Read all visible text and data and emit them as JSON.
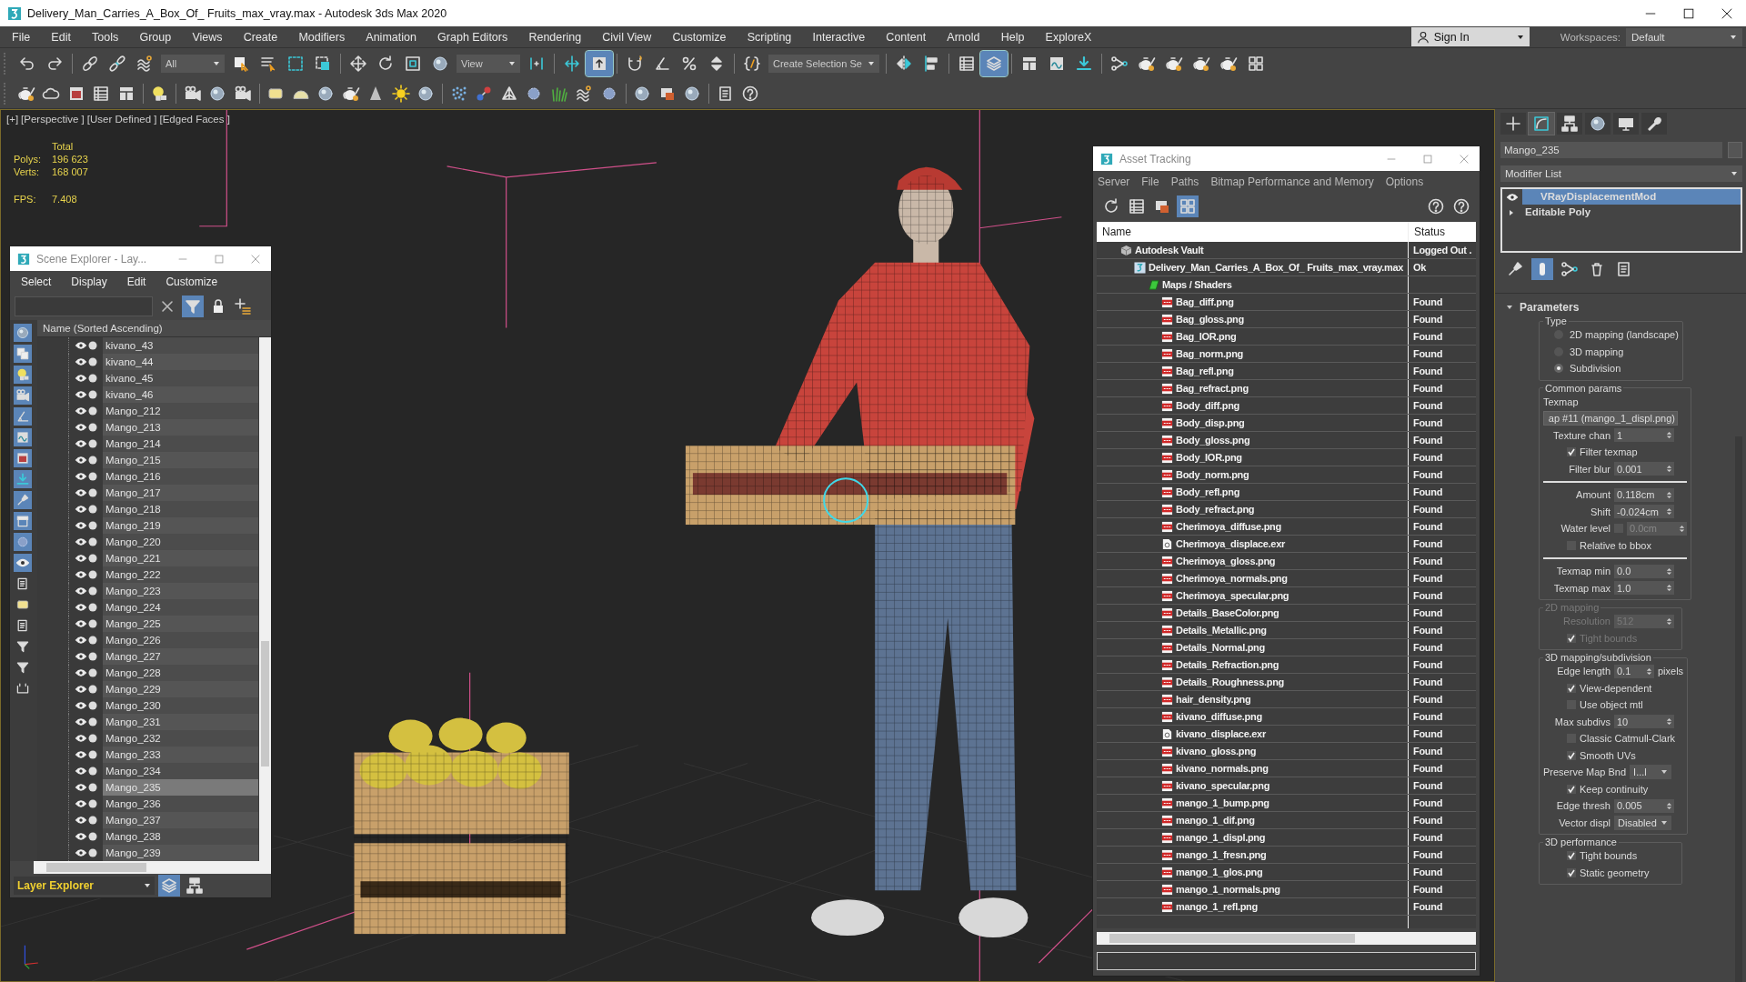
{
  "window": {
    "title": "Delivery_Man_Carries_A_Box_Of_ Fruits_max_vray.max - Autodesk 3ds Max 2020"
  },
  "menu": [
    "File",
    "Edit",
    "Tools",
    "Group",
    "Views",
    "Create",
    "Modifiers",
    "Animation",
    "Graph Editors",
    "Rendering",
    "Civil View",
    "Customize",
    "Scripting",
    "Interactive",
    "Content",
    "Arnold",
    "Help",
    "ExploreX"
  ],
  "sign_in": "Sign In",
  "workspaces": {
    "label": "Workspaces:",
    "value": "Default"
  },
  "toolbar_main": [
    {
      "kind": "button",
      "selected": false
    },
    {
      "kind": "button",
      "selected": false
    },
    {
      "kind": "separator"
    },
    {
      "kind": "button",
      "selected": false
    },
    {
      "kind": "button",
      "selected": false
    },
    {
      "kind": "button",
      "selected": false
    },
    {
      "kind": "dropdown",
      "value": "All"
    },
    {
      "kind": "button",
      "selected": false
    },
    {
      "kind": "button",
      "selected": false
    },
    {
      "kind": "button",
      "selected": false
    },
    {
      "kind": "button",
      "selected": false
    },
    {
      "kind": "separator"
    },
    {
      "kind": "button",
      "selected": false
    },
    {
      "kind": "button",
      "selected": false
    },
    {
      "kind": "button",
      "selected": false
    },
    {
      "kind": "button",
      "selected": false
    },
    {
      "kind": "dropdown",
      "value": "View"
    },
    {
      "kind": "button",
      "selected": false
    },
    {
      "kind": "separator"
    },
    {
      "kind": "button",
      "selected": false
    },
    {
      "kind": "button",
      "selected": true
    },
    {
      "kind": "separator"
    },
    {
      "kind": "button",
      "selected": false
    },
    {
      "kind": "button",
      "selected": false
    },
    {
      "kind": "button",
      "selected": false
    },
    {
      "kind": "button",
      "selected": false
    },
    {
      "kind": "separator"
    },
    {
      "kind": "button",
      "selected": false
    },
    {
      "kind": "dropdown",
      "value": "Create Selection Se"
    },
    {
      "kind": "separator"
    },
    {
      "kind": "button",
      "selected": false
    },
    {
      "kind": "button",
      "selected": false
    },
    {
      "kind": "separator"
    },
    {
      "kind": "button",
      "selected": false
    },
    {
      "kind": "button",
      "selected": true
    },
    {
      "kind": "separator"
    },
    {
      "kind": "button",
      "selected": false
    },
    {
      "kind": "button",
      "selected": false
    },
    {
      "kind": "button",
      "selected": false
    },
    {
      "kind": "separator"
    },
    {
      "kind": "button",
      "selected": false
    },
    {
      "kind": "button",
      "selected": false
    },
    {
      "kind": "button",
      "selected": false
    },
    {
      "kind": "button",
      "selected": false
    },
    {
      "kind": "button",
      "selected": false
    },
    {
      "kind": "button",
      "selected": false
    }
  ],
  "toolbar_create": [
    {
      "kind": "button",
      "selected": false
    },
    {
      "kind": "button",
      "selected": false
    },
    {
      "kind": "button",
      "selected": false
    },
    {
      "kind": "button",
      "selected": false
    },
    {
      "kind": "button",
      "selected": false
    },
    {
      "kind": "separator"
    },
    {
      "kind": "button",
      "selected": false
    },
    {
      "kind": "separator"
    },
    {
      "kind": "button",
      "selected": false
    },
    {
      "kind": "button",
      "selected": false
    },
    {
      "kind": "button",
      "selected": false
    },
    {
      "kind": "separator"
    },
    {
      "kind": "button",
      "selected": false
    },
    {
      "kind": "button",
      "selected": false
    },
    {
      "kind": "button",
      "selected": false
    },
    {
      "kind": "button",
      "selected": false
    },
    {
      "kind": "button",
      "selected": false
    },
    {
      "kind": "button",
      "selected": false
    },
    {
      "kind": "button",
      "selected": false
    },
    {
      "kind": "separator"
    },
    {
      "kind": "button",
      "selected": false
    },
    {
      "kind": "button",
      "selected": false
    },
    {
      "kind": "button",
      "selected": false
    },
    {
      "kind": "button",
      "selected": false
    },
    {
      "kind": "button",
      "selected": false
    },
    {
      "kind": "button",
      "selected": false
    },
    {
      "kind": "button",
      "selected": false
    },
    {
      "kind": "separator"
    },
    {
      "kind": "button",
      "selected": false
    },
    {
      "kind": "button",
      "selected": false
    },
    {
      "kind": "button",
      "selected": false
    },
    {
      "kind": "separator"
    },
    {
      "kind": "button",
      "selected": false
    },
    {
      "kind": "button",
      "selected": false
    }
  ],
  "viewport": {
    "labels": [
      "[+]",
      "[Perspective ]",
      "[User Defined ]",
      "[Edged Faces ]"
    ],
    "stats": {
      "heading": "Total",
      "rows": [
        {
          "label": "Polys:",
          "value": "196 623"
        },
        {
          "label": "Verts:",
          "value": "168 007"
        }
      ],
      "fps_label": "FPS:",
      "fps": "7.408"
    }
  },
  "scene_explorer": {
    "title": "Scene Explorer - Lay...",
    "menu": [
      "Select",
      "Display",
      "Edit",
      "Customize"
    ],
    "tools": [
      {
        "selected": false
      },
      {
        "selected": true
      },
      {
        "selected": false
      },
      {
        "selected": false
      }
    ],
    "filters": [
      {
        "on": true
      },
      {
        "on": true
      },
      {
        "on": true
      },
      {
        "on": true
      },
      {
        "on": true
      },
      {
        "on": true
      },
      {
        "on": true
      },
      {
        "on": true
      },
      {
        "on": true
      },
      {
        "on": true
      },
      {
        "on": true
      },
      {
        "on": true
      },
      {
        "on": false
      },
      {
        "on": false
      },
      {
        "on": false
      },
      {
        "on": false
      },
      {
        "on": false
      },
      {
        "on": false
      }
    ],
    "column": "Name (Sorted Ascending)",
    "rows": [
      {
        "name": "kivano_43",
        "selected": false
      },
      {
        "name": "kivano_44",
        "selected": false
      },
      {
        "name": "kivano_45",
        "selected": false
      },
      {
        "name": "kivano_46",
        "selected": false
      },
      {
        "name": "Mango_212",
        "selected": false
      },
      {
        "name": "Mango_213",
        "selected": false
      },
      {
        "name": "Mango_214",
        "selected": false
      },
      {
        "name": "Mango_215",
        "selected": false
      },
      {
        "name": "Mango_216",
        "selected": false
      },
      {
        "name": "Mango_217",
        "selected": false
      },
      {
        "name": "Mango_218",
        "selected": false
      },
      {
        "name": "Mango_219",
        "selected": false
      },
      {
        "name": "Mango_220",
        "selected": false
      },
      {
        "name": "Mango_221",
        "selected": false
      },
      {
        "name": "Mango_222",
        "selected": false
      },
      {
        "name": "Mango_223",
        "selected": false
      },
      {
        "name": "Mango_224",
        "selected": false
      },
      {
        "name": "Mango_225",
        "selected": false
      },
      {
        "name": "Mango_226",
        "selected": false
      },
      {
        "name": "Mango_227",
        "selected": false
      },
      {
        "name": "Mango_228",
        "selected": false
      },
      {
        "name": "Mango_229",
        "selected": false
      },
      {
        "name": "Mango_230",
        "selected": false
      },
      {
        "name": "Mango_231",
        "selected": false
      },
      {
        "name": "Mango_232",
        "selected": false
      },
      {
        "name": "Mango_233",
        "selected": false
      },
      {
        "name": "Mango_234",
        "selected": false
      },
      {
        "name": "Mango_235",
        "selected": true
      },
      {
        "name": "Mango_236",
        "selected": false
      },
      {
        "name": "Mango_237",
        "selected": false
      },
      {
        "name": "Mango_238",
        "selected": false
      },
      {
        "name": "Mango_239",
        "selected": false
      }
    ],
    "footer": {
      "value": "Layer Explorer",
      "buttons": [
        {
          "selected": true
        },
        {
          "selected": false
        }
      ]
    }
  },
  "asset_tracking": {
    "title": "Asset Tracking",
    "menu": [
      "Server",
      "File",
      "Paths",
      "Bitmap Performance and Memory",
      "Options"
    ],
    "toolbar_left": [
      {
        "selected": false
      },
      {
        "selected": false
      },
      {
        "selected": false
      },
      {
        "selected": true
      }
    ],
    "toolbar_right": [
      {
        "selected": false
      },
      {
        "selected": false
      }
    ],
    "columns": [
      "Name",
      "Status"
    ],
    "tree": [
      {
        "name": "Autodesk Vault",
        "status": "Logged Out .",
        "kind": "vault",
        "children": [
          {
            "name": "Delivery_Man_Carries_A_Box_Of_ Fruits_max_vray.max",
            "status": "Ok",
            "kind": "scene",
            "children": [
              {
                "name": "Maps / Shaders",
                "kind": "folder",
                "children": [
                  {
                    "name": "Bag_diff.png",
                    "status": "Found",
                    "kind": "png"
                  },
                  {
                    "name": "Bag_gloss.png",
                    "status": "Found",
                    "kind": "png"
                  },
                  {
                    "name": "Bag_IOR.png",
                    "status": "Found",
                    "kind": "png"
                  },
                  {
                    "name": "Bag_norm.png",
                    "status": "Found",
                    "kind": "png"
                  },
                  {
                    "name": "Bag_refl.png",
                    "status": "Found",
                    "kind": "png"
                  },
                  {
                    "name": "Bag_refract.png",
                    "status": "Found",
                    "kind": "png"
                  },
                  {
                    "name": "Body_diff.png",
                    "status": "Found",
                    "kind": "png"
                  },
                  {
                    "name": "Body_disp.png",
                    "status": "Found",
                    "kind": "png"
                  },
                  {
                    "name": "Body_gloss.png",
                    "status": "Found",
                    "kind": "png"
                  },
                  {
                    "name": "Body_IOR.png",
                    "status": "Found",
                    "kind": "png"
                  },
                  {
                    "name": "Body_norm.png",
                    "status": "Found",
                    "kind": "png"
                  },
                  {
                    "name": "Body_refl.png",
                    "status": "Found",
                    "kind": "png"
                  },
                  {
                    "name": "Body_refract.png",
                    "status": "Found",
                    "kind": "png"
                  },
                  {
                    "name": "Cherimoya_diffuse.png",
                    "status": "Found",
                    "kind": "png"
                  },
                  {
                    "name": "Cherimoya_displace.exr",
                    "status": "Found",
                    "kind": "exr"
                  },
                  {
                    "name": "Cherimoya_gloss.png",
                    "status": "Found",
                    "kind": "png"
                  },
                  {
                    "name": "Cherimoya_normals.png",
                    "status": "Found",
                    "kind": "png"
                  },
                  {
                    "name": "Cherimoya_specular.png",
                    "status": "Found",
                    "kind": "png"
                  },
                  {
                    "name": "Details_BaseColor.png",
                    "status": "Found",
                    "kind": "png"
                  },
                  {
                    "name": "Details_Metallic.png",
                    "status": "Found",
                    "kind": "png"
                  },
                  {
                    "name": "Details_Normal.png",
                    "status": "Found",
                    "kind": "png"
                  },
                  {
                    "name": "Details_Refraction.png",
                    "status": "Found",
                    "kind": "png"
                  },
                  {
                    "name": "Details_Roughness.png",
                    "status": "Found",
                    "kind": "png"
                  },
                  {
                    "name": "hair_density.png",
                    "status": "Found",
                    "kind": "png"
                  },
                  {
                    "name": "kivano_diffuse.png",
                    "status": "Found",
                    "kind": "png"
                  },
                  {
                    "name": "kivano_displace.exr",
                    "status": "Found",
                    "kind": "exr"
                  },
                  {
                    "name": "kivano_gloss.png",
                    "status": "Found",
                    "kind": "png"
                  },
                  {
                    "name": "kivano_normals.png",
                    "status": "Found",
                    "kind": "png"
                  },
                  {
                    "name": "kivano_specular.png",
                    "status": "Found",
                    "kind": "png"
                  },
                  {
                    "name": "mango_1_bump.png",
                    "status": "Found",
                    "kind": "png"
                  },
                  {
                    "name": "mango_1_dif.png",
                    "status": "Found",
                    "kind": "png"
                  },
                  {
                    "name": "mango_1_displ.png",
                    "status": "Found",
                    "kind": "png"
                  },
                  {
                    "name": "mango_1_fresn.png",
                    "status": "Found",
                    "kind": "png"
                  },
                  {
                    "name": "mango_1_glos.png",
                    "status": "Found",
                    "kind": "png"
                  },
                  {
                    "name": "mango_1_normals.png",
                    "status": "Found",
                    "kind": "png"
                  },
                  {
                    "name": "mango_1_refl.png",
                    "status": "Found",
                    "kind": "png"
                  }
                ]
              }
            ]
          }
        ]
      }
    ]
  },
  "command_panel": {
    "tabs": [
      {
        "selected": false
      },
      {
        "selected": true
      },
      {
        "selected": false
      },
      {
        "selected": false
      },
      {
        "selected": false
      },
      {
        "selected": false
      }
    ],
    "object_name": "Mango_235",
    "modifier_list": "Modifier List",
    "stack": [
      {
        "name": "VRayDisplacementMod",
        "kind": "modifier",
        "selected": true
      },
      {
        "name": "Editable Poly",
        "kind": "base",
        "selected": false
      }
    ],
    "stack_tools": [
      {
        "selected": false
      },
      {
        "selected": true
      },
      {
        "selected": false
      },
      {
        "selected": false
      },
      {
        "selected": false
      }
    ],
    "rollout": {
      "title": "Parameters",
      "expanded": true,
      "groups": [
        {
          "title": "Type",
          "disabled": false,
          "rows": [
            {
              "kind": "radio",
              "label": "2D mapping (landscape)",
              "selected": false
            },
            {
              "kind": "radio",
              "label": "3D mapping",
              "selected": false
            },
            {
              "kind": "radio",
              "label": "Subdivision",
              "selected": true
            }
          ]
        },
        {
          "title": "Common params",
          "disabled": false,
          "rows": [
            {
              "kind": "label",
              "label": "Texmap"
            },
            {
              "kind": "map",
              "value": "ap #11 (mango_1_displ.png)"
            },
            {
              "kind": "spinner",
              "label": "Texture chan",
              "value": "1"
            },
            {
              "kind": "checkbox",
              "label": "Filter texmap",
              "checked": true
            },
            {
              "kind": "spinner",
              "label": "Filter blur",
              "value": "0.001"
            },
            {
              "kind": "divider"
            },
            {
              "kind": "spinner",
              "label": "Amount",
              "value": "0.118cm"
            },
            {
              "kind": "spinner",
              "label": "Shift",
              "value": "-0.024cm"
            },
            {
              "kind": "check_spinner",
              "label": "Water level",
              "checked": false,
              "value": "0.0cm"
            },
            {
              "kind": "checkbox",
              "label": "Relative to bbox",
              "checked": false
            },
            {
              "kind": "divider"
            },
            {
              "kind": "spinner",
              "label": "Texmap min",
              "value": "0.0"
            },
            {
              "kind": "spinner",
              "label": "Texmap max",
              "value": "1.0"
            }
          ]
        },
        {
          "title": "2D mapping",
          "disabled": true,
          "rows": [
            {
              "kind": "spinner",
              "label": "Resolution",
              "value": "512"
            },
            {
              "kind": "checkbox",
              "label": "Tight bounds",
              "checked": true
            }
          ]
        },
        {
          "title": "3D mapping/subdivision",
          "disabled": false,
          "rows": [
            {
              "kind": "spinner",
              "label": "Edge length",
              "value": "0.1",
              "unit": "pixels"
            },
            {
              "kind": "checkbox",
              "label": "View-dependent",
              "checked": true
            },
            {
              "kind": "checkbox",
              "label": "Use object mtl",
              "checked": false
            },
            {
              "kind": "spinner",
              "label": "Max subdivs",
              "value": "10"
            },
            {
              "kind": "checkbox",
              "label": "Classic Catmull-Clark",
              "checked": false
            },
            {
              "kind": "checkbox",
              "label": "Smooth UVs",
              "checked": true
            },
            {
              "kind": "dropdown",
              "label": "Preserve Map Bnd",
              "value": "I...l"
            },
            {
              "kind": "checkbox",
              "label": "Keep continuity",
              "checked": true
            },
            {
              "kind": "spinner",
              "label": "Edge thresh",
              "value": "0.005"
            },
            {
              "kind": "dropdown",
              "label": "Vector displ",
              "value": "Disabled"
            }
          ]
        },
        {
          "title": "3D performance",
          "disabled": false,
          "rows": [
            {
              "kind": "checkbox",
              "label": "Tight bounds",
              "checked": true
            },
            {
              "kind": "checkbox",
              "label": "Static geometry",
              "checked": true
            }
          ]
        }
      ]
    }
  }
}
